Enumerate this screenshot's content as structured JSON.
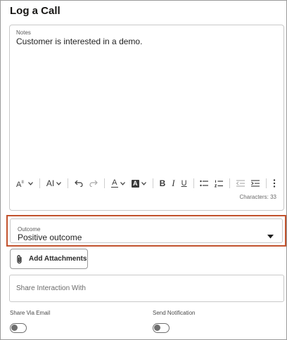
{
  "dialog": {
    "title": "Log a Call"
  },
  "notes": {
    "label": "Notes",
    "value": "Customer is interested in a demo.",
    "characters_label": "Characters: 33"
  },
  "toolbar": {
    "items": [
      "font-size-icon",
      "text-size-icon",
      "undo-icon",
      "redo-icon",
      "text-color-icon",
      "highlight-color-icon",
      "bold-icon",
      "italic-icon",
      "underline-icon",
      "bulleted-list-icon",
      "numbered-list-icon",
      "outdent-icon",
      "indent-icon",
      "more-options-icon"
    ],
    "labels": {
      "text_size": "AI",
      "text_color": "A",
      "highlight": "A",
      "bold": "B",
      "italic": "I",
      "underline": "U"
    }
  },
  "outcome": {
    "label": "Outcome",
    "value": "Positive outcome",
    "highlight_color": "#c2522d"
  },
  "attachments": {
    "button_label": "Add Attachments"
  },
  "share": {
    "placeholder": "Share Interaction With"
  },
  "toggles": {
    "share_via_email": {
      "label": "Share Via Email",
      "on": false
    },
    "send_notification": {
      "label": "Send Notification",
      "on": false
    }
  }
}
